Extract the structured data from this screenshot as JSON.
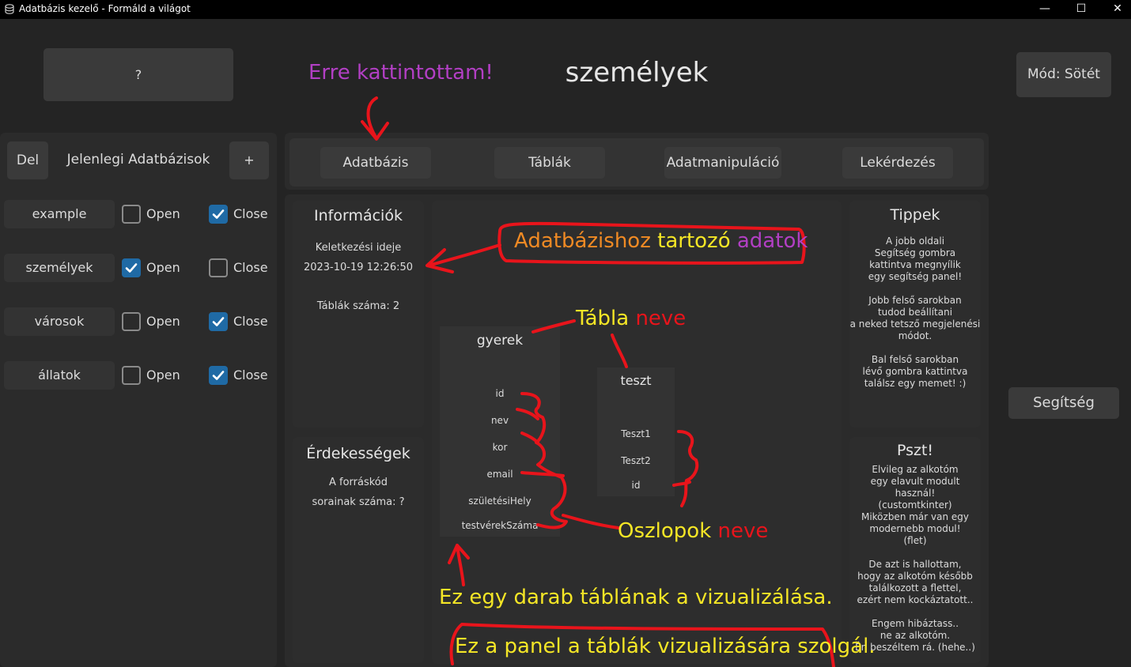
{
  "window": {
    "title": "Adatbázis kezelő - Formáld a világot",
    "controls": [
      "—",
      "☐",
      "✕"
    ]
  },
  "header": {
    "help_button": "?",
    "page_title": "személyek",
    "mode_button": "Mód: Sötét"
  },
  "sidebar": {
    "del_button": "Del",
    "title": "Jelenlegi Adatbázisok",
    "add_button": "+",
    "databases": [
      {
        "name": "example",
        "open_label": "Open",
        "open_checked": false,
        "close_label": "Close",
        "close_checked": true
      },
      {
        "name": "személyek",
        "open_label": "Open",
        "open_checked": true,
        "close_label": "Close",
        "close_checked": false
      },
      {
        "name": "városok",
        "open_label": "Open",
        "open_checked": false,
        "close_label": "Close",
        "close_checked": true
      },
      {
        "name": "állatok",
        "open_label": "Open",
        "open_checked": false,
        "close_label": "Close",
        "close_checked": true
      }
    ]
  },
  "tabs": [
    "Adatbázis",
    "Táblák",
    "Adatmanipuláció",
    "Lekérdezés"
  ],
  "info": {
    "title": "Információk",
    "created_label": "Keletkezési ideje",
    "created_value": "2023-10-19 12:26:50",
    "tables_count": "Táblák száma: 2"
  },
  "trivia": {
    "title": "Érdekességek",
    "line1": "A forráskód",
    "line2": "sorainak száma: ?"
  },
  "tables": [
    {
      "name": "gyerek",
      "columns": [
        "id",
        "nev",
        "kor",
        "email",
        "születésiHely",
        "testvérekSzáma"
      ]
    },
    {
      "name": "teszt",
      "columns": [
        "Teszt1",
        "Teszt2",
        "id"
      ]
    }
  ],
  "tips": {
    "title": "Tippek",
    "p1": "A jobb oldali\nSegítség gombra\nkattintva megnyílik\negy segítség panel!",
    "p2": "Jobb felső sarokban\ntudod beállítani\na neked tetsző megjelenési\nmódot.",
    "p3": "Bal felső sarokban\nlévő gombra kattintva\ntalálsz egy memet! :)"
  },
  "pszt": {
    "title": "Pszt!",
    "p1": "Elvileg az alkotóm\negy elavult modult használ!\n(customtkinter)\nMiközben már van egy\nmodernebb modul!\n(flet)",
    "p2": "De azt is hallottam,\nhogy az alkotóm később\ntalálkozott a flettel,\nezért nem kockáztatott..",
    "p3": "Engem hibáztass..\nne az alkotóm.\nÉn beszéltem rá. (hehe..)"
  },
  "help_button": "Segítség",
  "annotations": {
    "clicked": "Erre kattintottam!",
    "db_data_1": "Adatbázishoz",
    "db_data_2": "tartozó",
    "db_data_3": "adatok",
    "table_name_1": "Tábla",
    "table_name_2": "neve",
    "columns_1": "Oszlopok",
    "columns_2": "neve",
    "one_table": "Ez egy darab táblának a vizualizálása.",
    "panel": "Ez a panel a táblák vizualizására szolgál."
  },
  "colors": {
    "accent": "#1f6aa5",
    "annotation_red": "#e8141b",
    "annotation_yellow": "#f5e626",
    "annotation_orange": "#f08a24",
    "annotation_purple": "#b23fc4"
  }
}
